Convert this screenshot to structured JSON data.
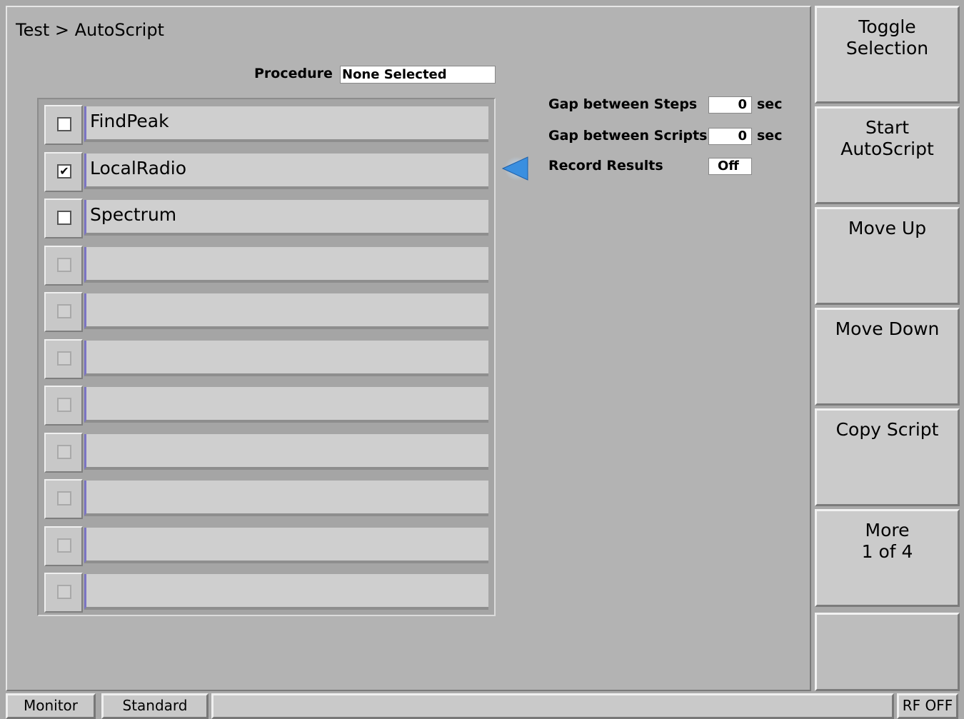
{
  "breadcrumb": "Test > AutoScript",
  "procedure": {
    "label": "Procedure",
    "value": "None Selected"
  },
  "scripts": [
    {
      "name": "FindPeak",
      "checked": false
    },
    {
      "name": "LocalRadio",
      "checked": true
    },
    {
      "name": "Spectrum",
      "checked": false
    },
    {
      "name": "",
      "checked": false
    },
    {
      "name": "",
      "checked": false
    },
    {
      "name": "",
      "checked": false
    },
    {
      "name": "",
      "checked": false
    },
    {
      "name": "",
      "checked": false
    },
    {
      "name": "",
      "checked": false
    },
    {
      "name": "",
      "checked": false
    },
    {
      "name": "",
      "checked": false
    }
  ],
  "settings": {
    "gap_steps": {
      "label": "Gap between Steps",
      "value": "0",
      "unit": "sec"
    },
    "gap_scripts": {
      "label": "Gap between Scripts",
      "value": "0",
      "unit": "sec"
    },
    "record_results": {
      "label": "Record Results",
      "value": "Off"
    }
  },
  "softkeys": {
    "toggle": {
      "line1": "Toggle",
      "line2": "Selection"
    },
    "start": {
      "line1": "Start",
      "line2": "AutoScript"
    },
    "move_up": {
      "line1": "Move Up",
      "line2": ""
    },
    "move_down": {
      "line1": "Move Down",
      "line2": ""
    },
    "copy": {
      "line1": "Copy Script",
      "line2": ""
    },
    "more": {
      "line1": "More",
      "line2": "1 of 4"
    }
  },
  "statusbar": {
    "mode": "Monitor",
    "standard": "Standard",
    "message": "",
    "rf": "RF OFF"
  },
  "colors": {
    "selection_arrow": "#3a8fe0",
    "row_accent": "#7b74c4"
  },
  "icons": {
    "selection_arrow": "triangle-left",
    "check": "✔"
  }
}
